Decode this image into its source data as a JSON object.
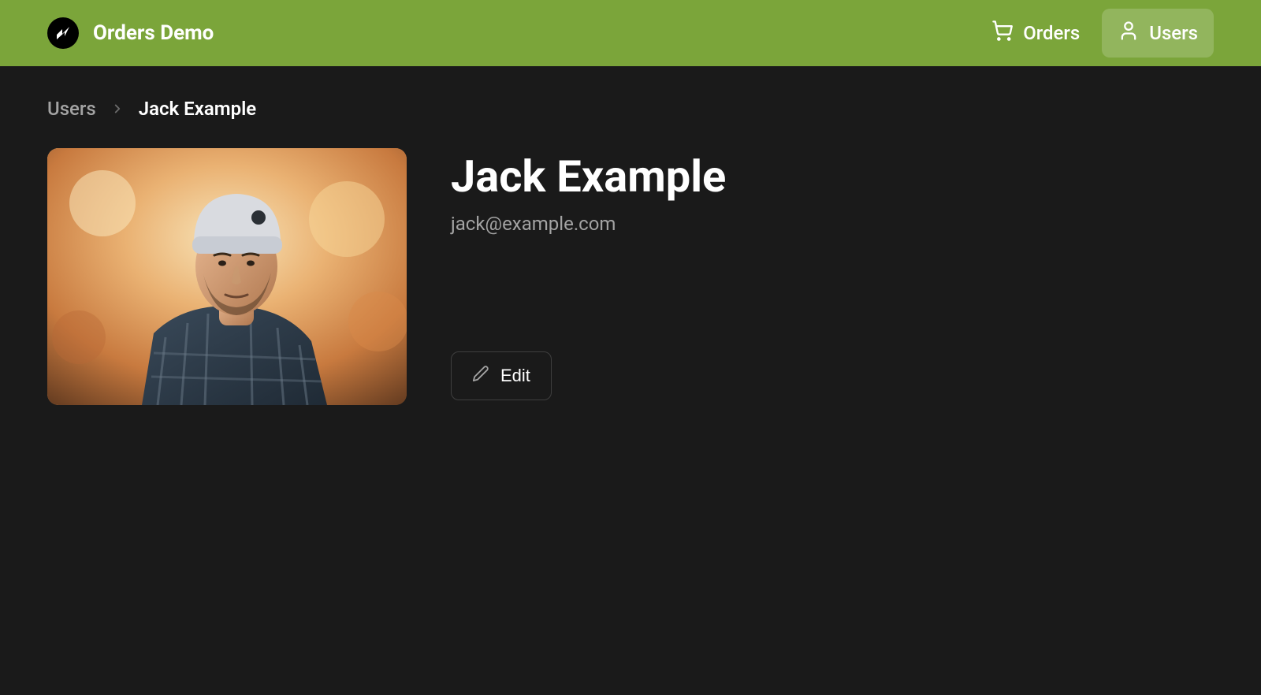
{
  "header": {
    "brand_title": "Orders Demo",
    "nav": {
      "orders_label": "Orders",
      "users_label": "Users"
    }
  },
  "breadcrumb": {
    "parent": "Users",
    "current": "Jack Example"
  },
  "profile": {
    "name": "Jack Example",
    "email": "jack@example.com",
    "edit_label": "Edit"
  }
}
